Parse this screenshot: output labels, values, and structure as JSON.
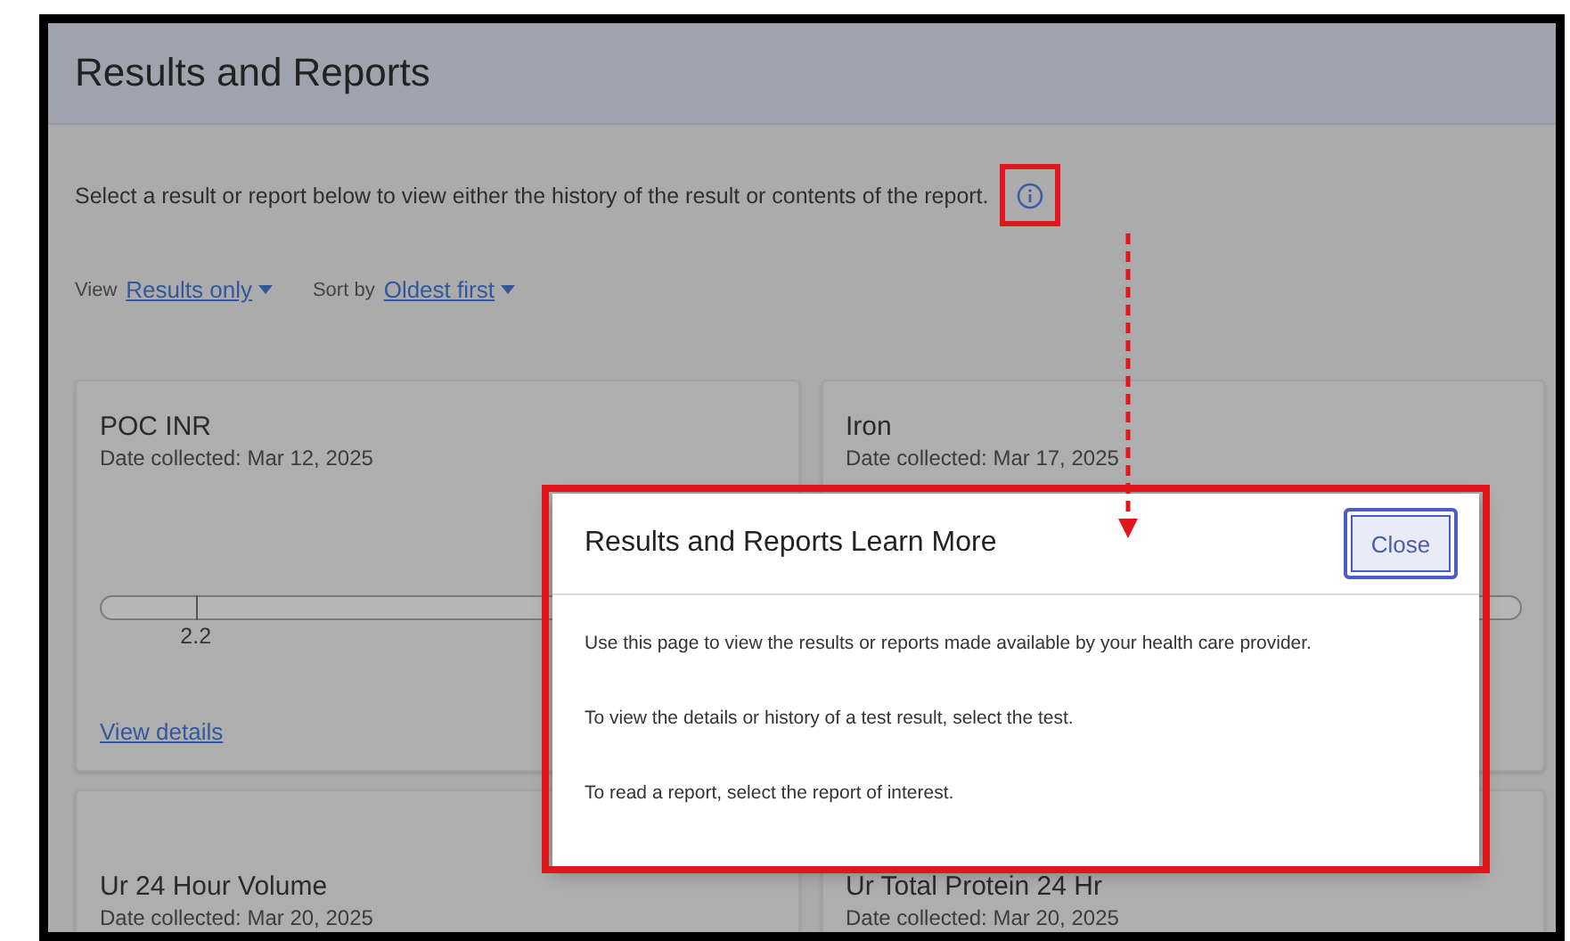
{
  "page": {
    "title": "Results and Reports",
    "description": "Select a result or report below to view either the history of the result or contents of the report."
  },
  "filters": [
    {
      "label": "View",
      "value": "Results only"
    },
    {
      "label": "Sort by",
      "value": "Oldest first"
    }
  ],
  "results": [
    {
      "kind": "range",
      "name": "POC INR",
      "date": "Date collected: Mar 12, 2025",
      "marker": {
        "value": "2.2",
        "level": 0.14
      },
      "link": "View details"
    },
    {
      "kind": "range",
      "name": "Iron",
      "date": "Date collected: Mar 17, 2025"
    },
    {
      "kind": "plain",
      "name": "Ur 24 Hour Volume",
      "date": "Date collected: Mar 20, 2025"
    },
    {
      "kind": "plain",
      "name": "Ur Total Protein 24 Hr",
      "date": "Date collected: Mar 20, 2025"
    }
  ],
  "dialog": {
    "title": "Results and Reports Learn More",
    "close": "Close",
    "paragraphs": [
      "Use this page to view the results or reports made available by your health care provider.",
      "To view the details or history of a test result, select the test.",
      "To read a report, select the report of interest."
    ]
  }
}
